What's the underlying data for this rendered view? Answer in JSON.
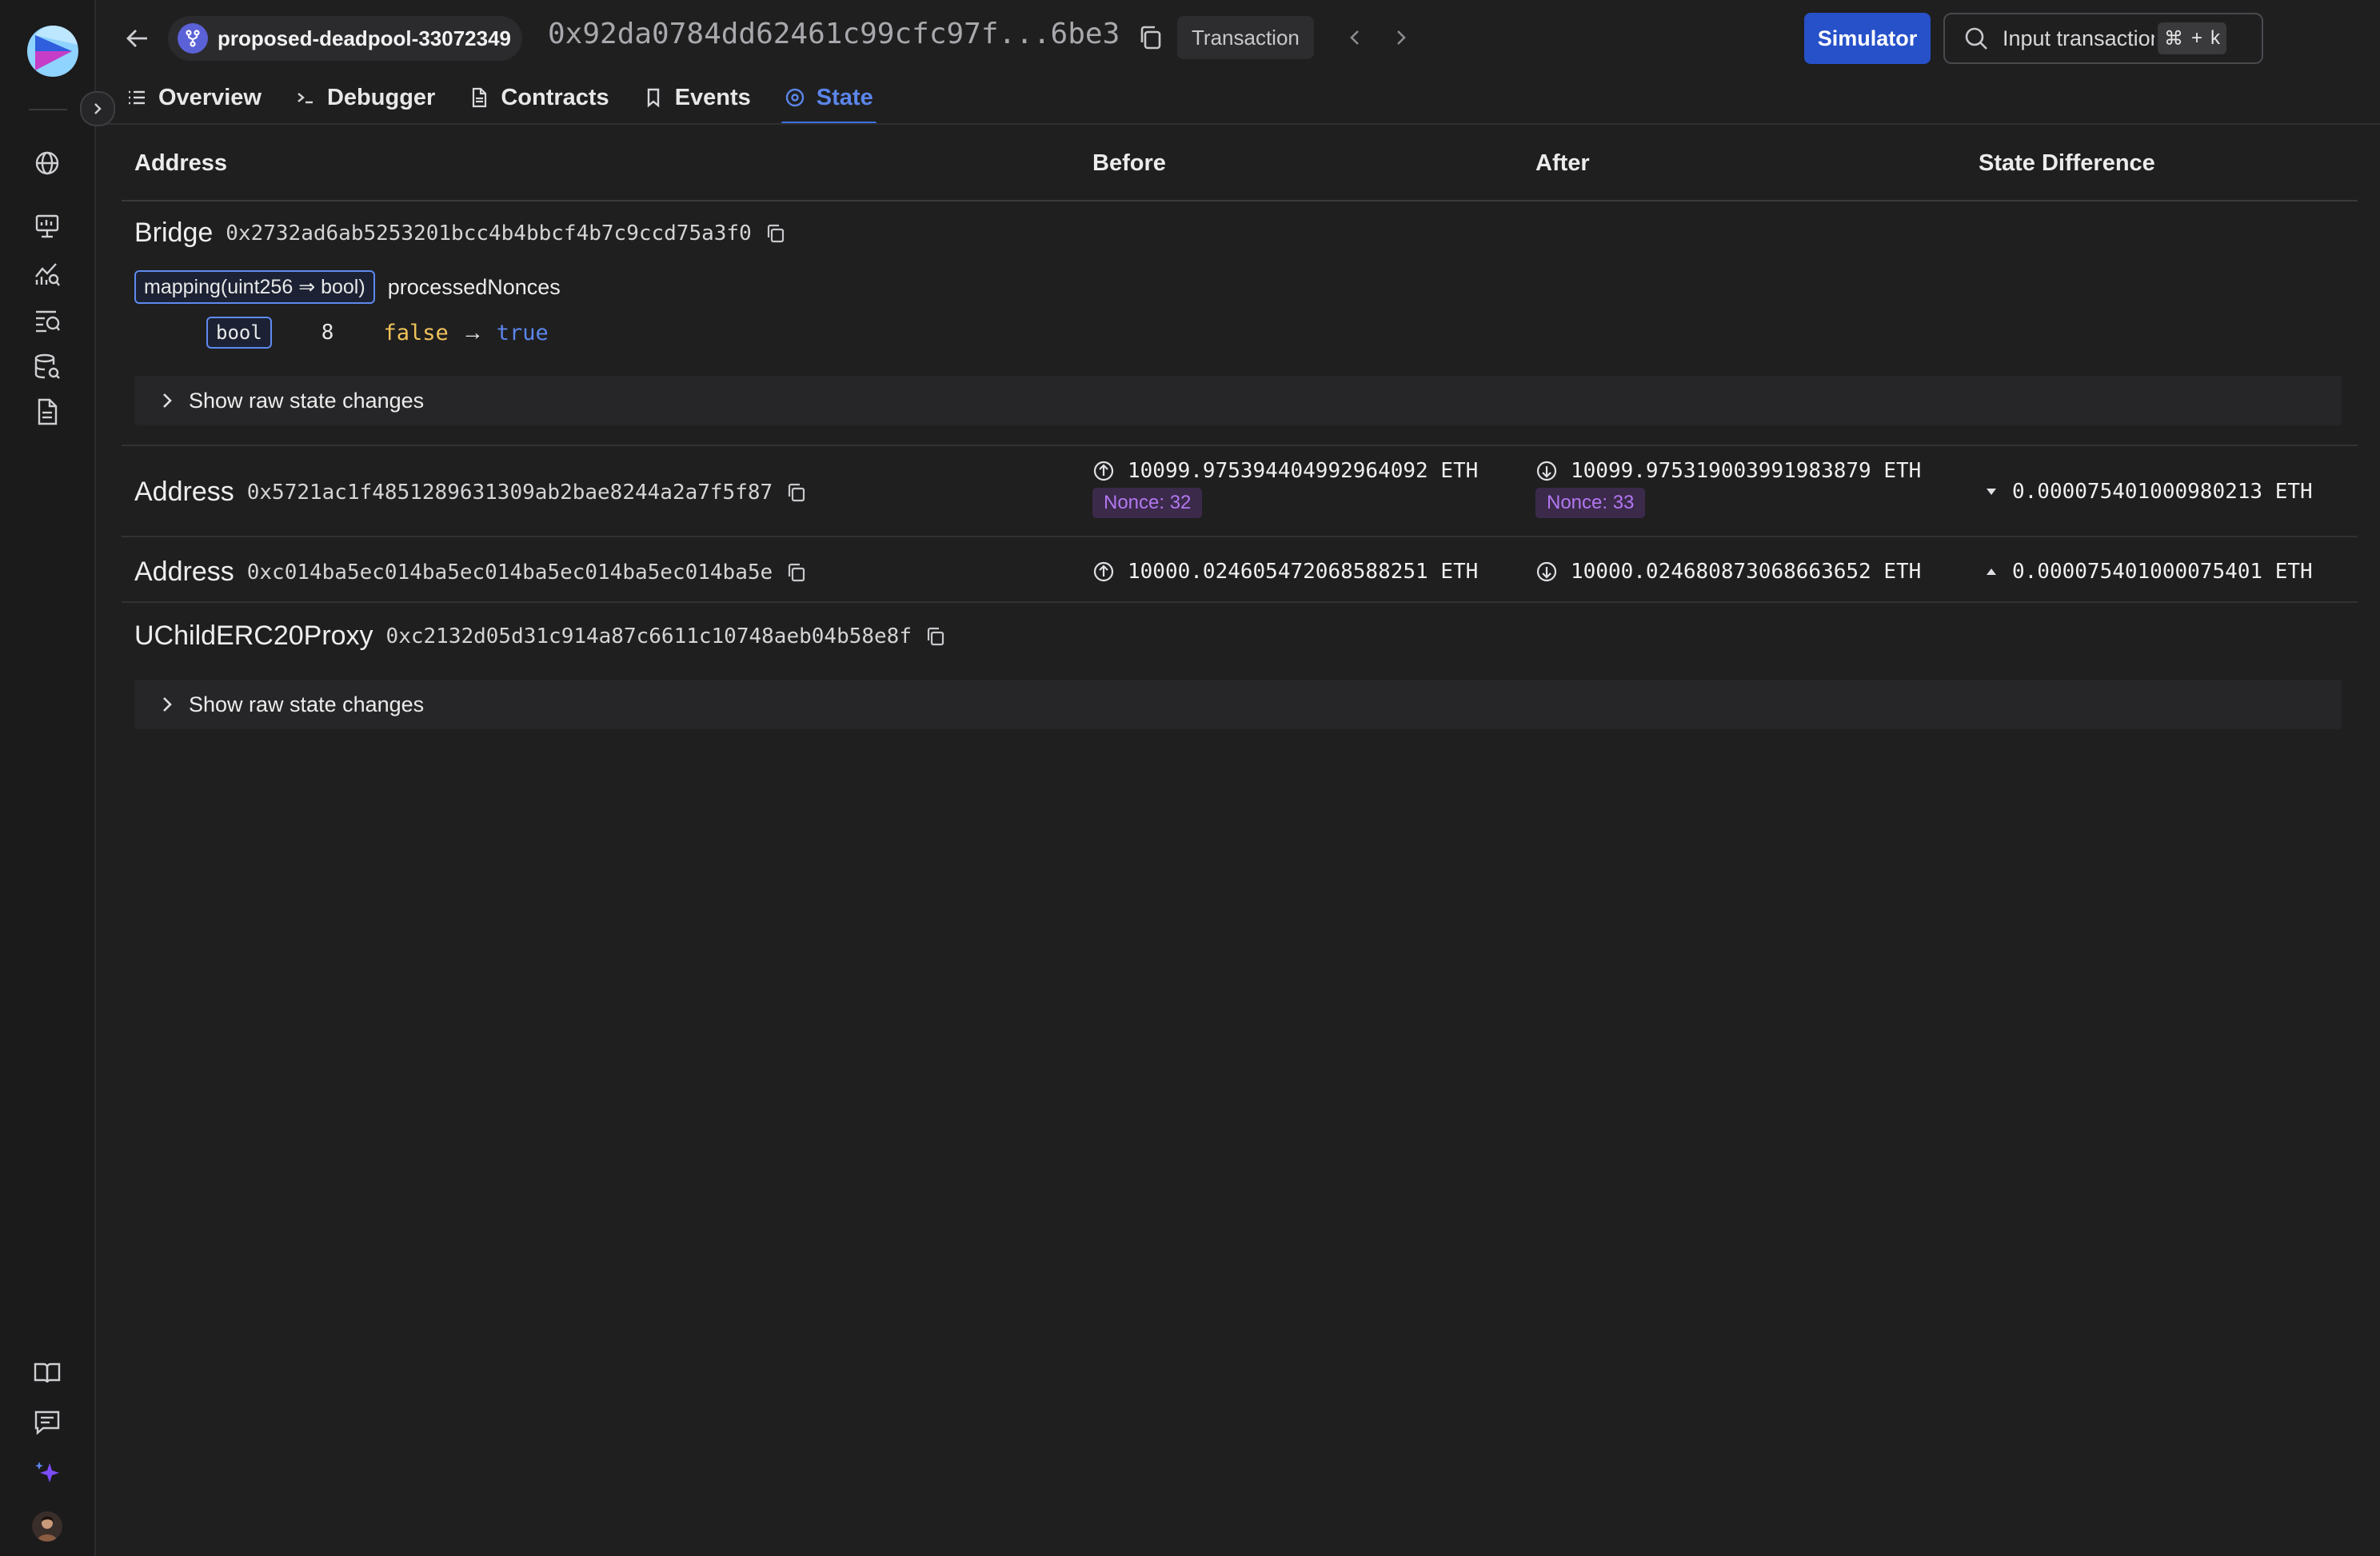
{
  "header": {
    "project_name": "proposed-deadpool-33072349",
    "tx_hash": "0x92da0784dd62461c99cfc97f...6be3",
    "tx_type": "Transaction",
    "simulator_label": "Simulator",
    "search_placeholder": "Input transaction",
    "shortcut_keys": [
      "⌘",
      "+",
      "k"
    ]
  },
  "tabs": [
    {
      "label": "Overview",
      "icon": "list-icon"
    },
    {
      "label": "Debugger",
      "icon": "terminal-icon"
    },
    {
      "label": "Contracts",
      "icon": "file-icon"
    },
    {
      "label": "Events",
      "icon": "bookmark-icon"
    },
    {
      "label": "State",
      "icon": "target-icon",
      "active": true
    }
  ],
  "table": {
    "columns": [
      "Address",
      "Before",
      "After",
      "State Difference"
    ],
    "raw_label": "Show raw state changes",
    "bridge": {
      "name": "Bridge",
      "address": "0x2732ad6ab5253201bcc4b4bbcf4b7c9ccd75a3f0",
      "mapping_type": "mapping(uint256 ⇒ bool)",
      "variable": "processedNonces",
      "value_type": "bool",
      "key": "8",
      "before": "false",
      "arrow": "→",
      "after": "true"
    },
    "rows": [
      {
        "label": "Address",
        "address": "0x5721ac1f4851289631309ab2bae8244a2a7f5f87",
        "before": "10099.975394404992964092 ETH",
        "before_nonce": "Nonce: 32",
        "after": "10099.975319003991983879 ETH",
        "after_nonce": "Nonce: 33",
        "diff": "0.000075401000980213 ETH",
        "diff_direction": "down"
      },
      {
        "label": "Address",
        "address": "0xc014ba5ec014ba5ec014ba5ec014ba5ec014ba5e",
        "before": "10000.024605472068588251 ETH",
        "after": "10000.024680873068663652 ETH",
        "diff": "0.000075401000075401 ETH",
        "diff_direction": "up"
      }
    ],
    "proxy": {
      "name": "UChildERC20Proxy",
      "address": "0xc2132d05d31c914a87c6611c10748aeb04b58e8f"
    }
  },
  "colors": {
    "accent": "#2751c9",
    "active_tab": "#5b86ea",
    "false_value": "#f0c35a",
    "true_value": "#5b86ea",
    "nonce": "#b277f0"
  }
}
